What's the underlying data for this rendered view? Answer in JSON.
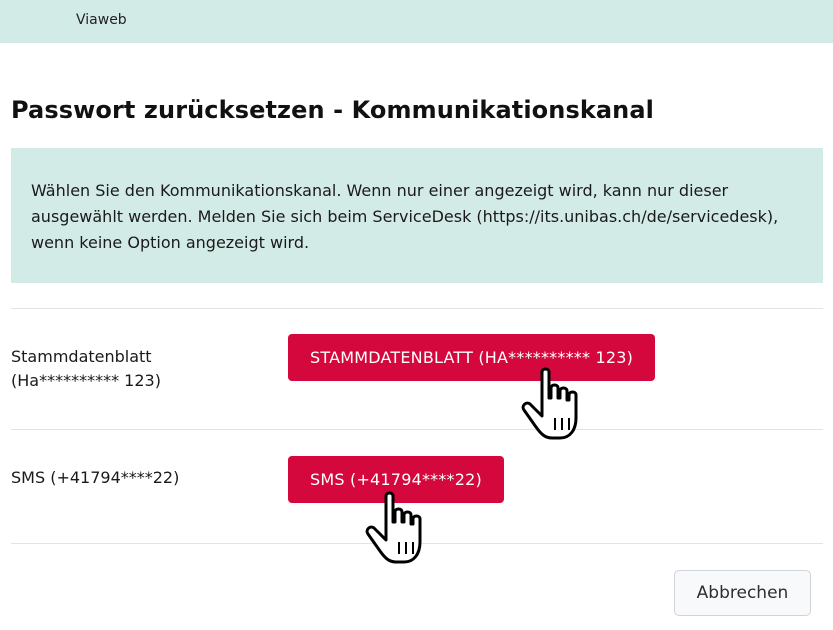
{
  "header": {
    "brand": "Viaweb"
  },
  "page": {
    "title": "Passwort zurücksetzen - Kommunikationskanal",
    "info": "Wählen Sie den Kommunikationskanal. Wenn nur einer angezeigt wird, kann nur dieser ausgewählt werden. Melden Sie sich beim ServiceDesk (https://its.unibas.ch/de/servicedesk), wenn keine Option angezeigt wird."
  },
  "channels": [
    {
      "label_line1": "Stammdatenblatt",
      "label_line2": "(Ha********** 123)",
      "button_label": "STAMMDATENBLATT (HA********** 123)"
    },
    {
      "label_line1": "SMS (+41794****22)",
      "button_label": "SMS (+41794****22)"
    }
  ],
  "actions": {
    "cancel_label": "Abbrechen"
  },
  "colors": {
    "accent": "#d4083c",
    "panel": "#d3ebe6"
  },
  "icons": {
    "cursor": "hand-pointer-icon"
  }
}
